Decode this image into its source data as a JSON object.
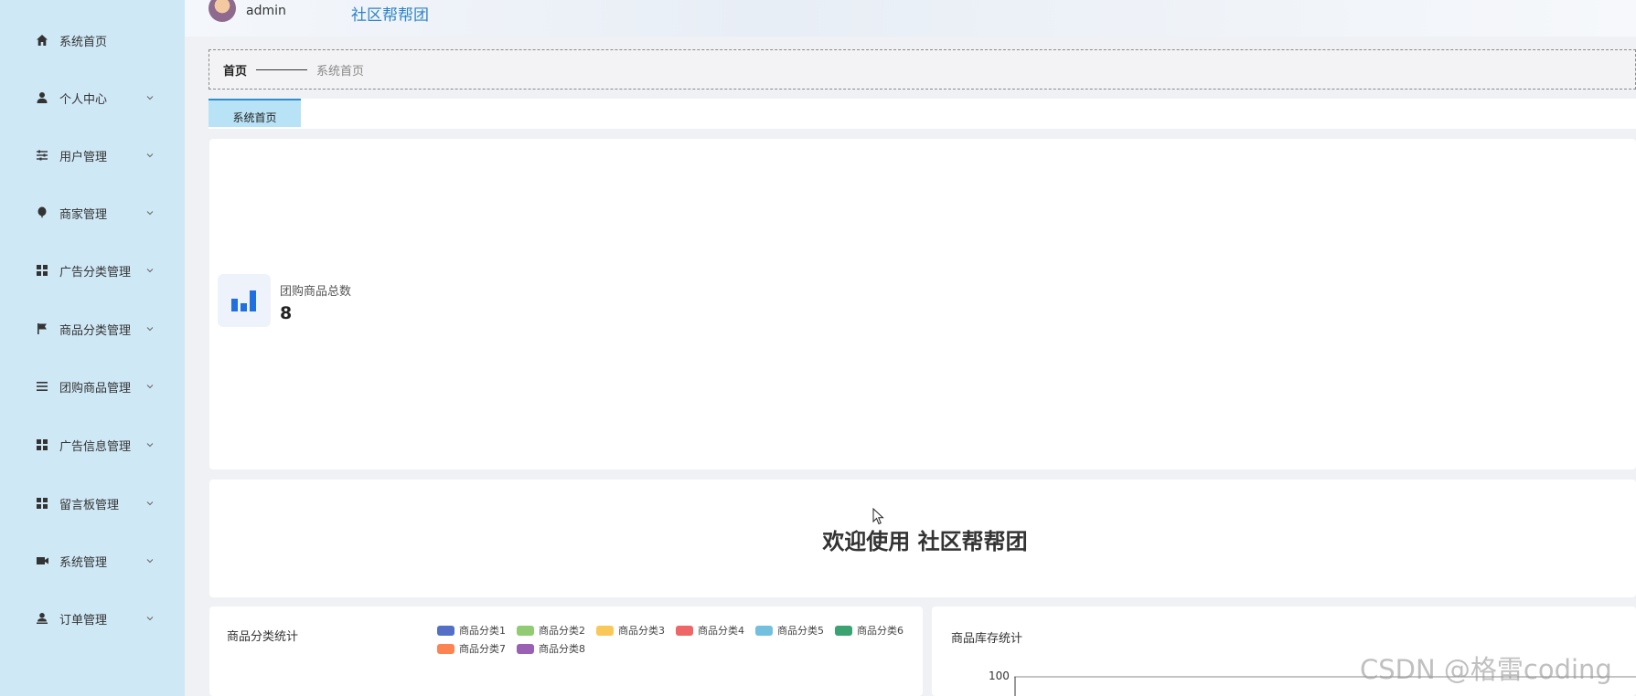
{
  "header": {
    "username": "admin",
    "site_title": "社区帮帮团"
  },
  "sidebar": {
    "items": [
      {
        "label": "系统首页",
        "icon": "home-icon",
        "has_submenu": false
      },
      {
        "label": "个人中心",
        "icon": "user-icon",
        "has_submenu": true
      },
      {
        "label": "用户管理",
        "icon": "sliders-icon",
        "has_submenu": true
      },
      {
        "label": "商家管理",
        "icon": "balloon-icon",
        "has_submenu": true
      },
      {
        "label": "广告分类管理",
        "icon": "grid-icon",
        "has_submenu": true
      },
      {
        "label": "商品分类管理",
        "icon": "flag-icon",
        "has_submenu": true
      },
      {
        "label": "团购商品管理",
        "icon": "list-icon",
        "has_submenu": true
      },
      {
        "label": "广告信息管理",
        "icon": "grid-icon",
        "has_submenu": true
      },
      {
        "label": "留言板管理",
        "icon": "grid-icon",
        "has_submenu": true
      },
      {
        "label": "系统管理",
        "icon": "video-camera-icon",
        "has_submenu": true
      },
      {
        "label": "订单管理",
        "icon": "user-upload-icon",
        "has_submenu": true
      }
    ]
  },
  "breadcrumb": {
    "home": "首页",
    "current": "系统首页"
  },
  "tabs": [
    {
      "label": "系统首页",
      "active": true
    }
  ],
  "stats": {
    "label": "团购商品总数",
    "value": "8",
    "icon": "bar-chart-icon"
  },
  "welcome": {
    "text": "欢迎使用 社区帮帮团"
  },
  "chart_category": {
    "title": "商品分类统计",
    "legend": [
      {
        "name": "商品分类1",
        "color": "#5470c6"
      },
      {
        "name": "商品分类2",
        "color": "#91cc75"
      },
      {
        "name": "商品分类3",
        "color": "#fac858"
      },
      {
        "name": "商品分类4",
        "color": "#ee6666"
      },
      {
        "name": "商品分类5",
        "color": "#73c0de"
      },
      {
        "name": "商品分类6",
        "color": "#3ba272"
      },
      {
        "name": "商品分类7",
        "color": "#fc8452"
      },
      {
        "name": "商品分类8",
        "color": "#9a60b4"
      }
    ]
  },
  "chart_stock": {
    "title": "商品库存统计",
    "y_tick_top": "100"
  },
  "watermark": "CSDN @格雷coding",
  "colors": {
    "sidebar_bg": "#cfe8f6",
    "accent": "#2e8fd0",
    "active_tab_bg": "#b8e2f5",
    "stat_icon": "#1f6fe0"
  }
}
